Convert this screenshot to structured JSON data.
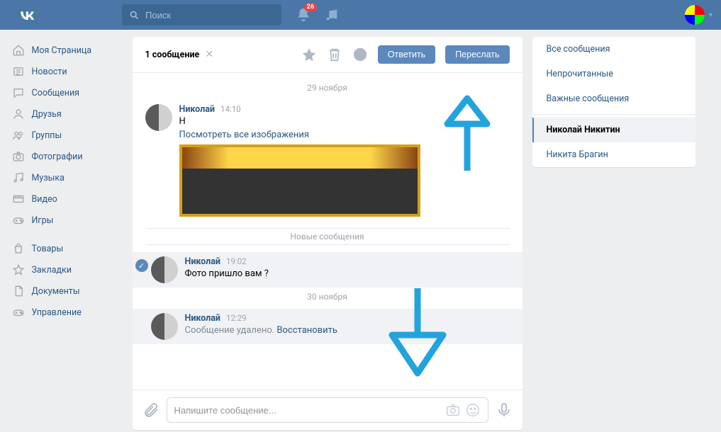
{
  "header": {
    "search_placeholder": "Поиск",
    "notif_count": "26"
  },
  "sidebar": {
    "items": [
      {
        "label": "Моя Страница",
        "icon": "home"
      },
      {
        "label": "Новости",
        "icon": "news"
      },
      {
        "label": "Сообщения",
        "icon": "chat"
      },
      {
        "label": "Друзья",
        "icon": "friends"
      },
      {
        "label": "Группы",
        "icon": "groups"
      },
      {
        "label": "Фотографии",
        "icon": "camera"
      },
      {
        "label": "Музыка",
        "icon": "music"
      },
      {
        "label": "Видео",
        "icon": "video"
      },
      {
        "label": "Игры",
        "icon": "games"
      }
    ],
    "items2": [
      {
        "label": "Товары",
        "icon": "bag"
      },
      {
        "label": "Закладки",
        "icon": "star"
      },
      {
        "label": "Документы",
        "icon": "doc"
      },
      {
        "label": "Управление",
        "icon": "gamepad"
      }
    ]
  },
  "chat": {
    "selection_label": "1 сообщение",
    "reply_btn": "Ответить",
    "forward_btn": "Переслать",
    "date1": "29 ноября",
    "new_label": "Новые сообщения",
    "date2": "30 ноября",
    "msg1": {
      "name": "Николай",
      "time": "14:10",
      "text": "Н",
      "link": "Посмотреть все изображения"
    },
    "msg2": {
      "name": "Николай",
      "time": "19:02",
      "text": "Фото пришло вам ?"
    },
    "msg3": {
      "name": "Николай",
      "time": "12:29",
      "deleted": "Сообщение удалено.",
      "restore": "Восстановить"
    },
    "input_placeholder": "Напишите сообщение..."
  },
  "filters": {
    "all": "Все сообщения",
    "unread": "Непрочитанные",
    "important": "Важные сообщения",
    "conv1": "Николай Никитин",
    "conv2": "Никита Брагин"
  }
}
